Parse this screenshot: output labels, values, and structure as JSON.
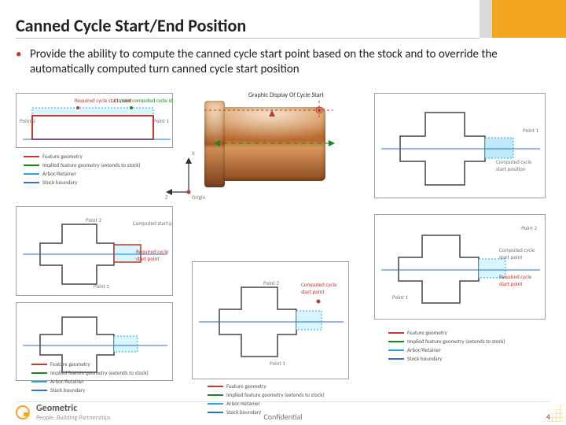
{
  "title": "Canned Cycle Start/End Position",
  "bullet_text": "Provide the ability to compute the canned cycle start point based on the stock and to override the automatically computed turn canned cycle start position",
  "panels": {
    "top_left": {
      "top_labels": [
        "Required cycle start point",
        "Current computed cycle start point"
      ],
      "side_left": "Point 2",
      "side_right": "Point 1"
    },
    "legend_left": [
      "Feature geometry",
      "Implied feature geometry (extends to stock)",
      "Arbor/Retainer",
      "Stock boundary"
    ],
    "axes": {
      "x": "X",
      "z": "Z",
      "origin": "Origin"
    },
    "mid_left_labels": {
      "p2": "Point 2",
      "p1": "Point 1",
      "box": "Computed start point",
      "red_box": "Required cycle start point"
    },
    "bottom_left_legend": [
      "Feature geometry",
      "Implied feature geometry (extends to stock)",
      "Arbor/Retainer",
      "Stock boundary"
    ],
    "center_label": "Graphic Display Of Cycle Start",
    "bottom_center_labels": {
      "p2": "Point 2",
      "p1": "Point 1",
      "top_note": "Computed cycle start point"
    },
    "bottom_center_legend": [
      "Feature geometry",
      "Implied feature geometry (extends to stock)",
      "Arbor/Retainer",
      "Stock boundary"
    ],
    "top_right_labels": {
      "pt": "Point 1",
      "note": "Computed cycle start position"
    },
    "right_mid_labels": {
      "title": "Point 2",
      "comp": "Computed cycle start point",
      "req": "Required cycle start point",
      "pt1": "Point 1"
    },
    "right_legend": [
      "Feature geometry",
      "Implied feature geometry (extends to stock)",
      "Arbor/Retainer",
      "Stock boundary"
    ]
  },
  "footer": {
    "brand": "Geometric",
    "tagline": "People. Building Partnerships",
    "confidential": "Confidential",
    "page": "4"
  }
}
